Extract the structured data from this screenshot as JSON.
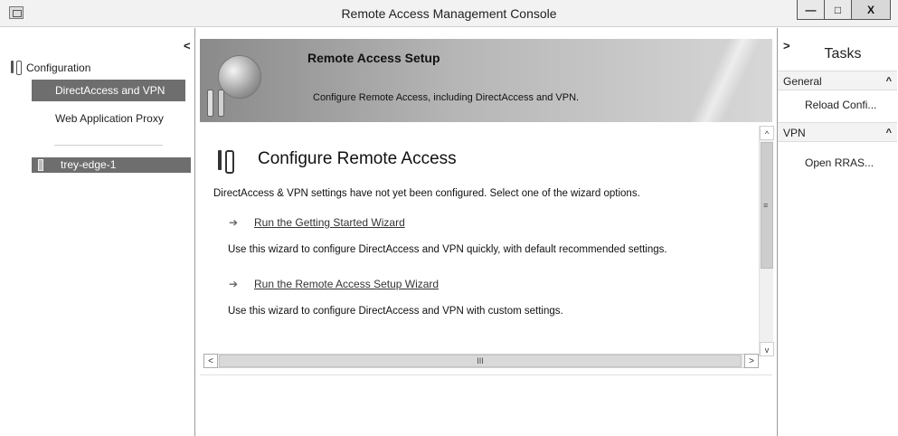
{
  "window": {
    "title": "Remote Access Management Console",
    "minimize_glyph": "—",
    "maximize_glyph": "□",
    "close_glyph": "X"
  },
  "left_pane": {
    "collapse_glyph": "<",
    "root_label": "Configuration",
    "items": [
      {
        "label": "DirectAccess and VPN",
        "selected": true
      },
      {
        "label": "Web Application Proxy",
        "selected": false
      }
    ],
    "server": {
      "label": "trey-edge-1"
    }
  },
  "banner": {
    "title": "Remote Access Setup",
    "subtitle": "Configure Remote Access, including DirectAccess and VPN."
  },
  "main": {
    "title": "Configure Remote Access",
    "intro": "DirectAccess & VPN settings have not yet been configured. Select one of the wizard options.",
    "wizards": [
      {
        "link": "Run the Getting Started Wizard",
        "description": "Use this wizard to configure DirectAccess and VPN quickly, with default recommended settings."
      },
      {
        "link": "Run the Remote Access Setup Wizard",
        "description": "Use this wizard to configure DirectAccess and VPN with custom settings."
      }
    ],
    "scroll": {
      "up": "^",
      "down": "v",
      "grip": "≡",
      "left": "<",
      "right": ">",
      "hgrip": "III"
    }
  },
  "right_pane": {
    "expand_glyph": ">",
    "title": "Tasks",
    "sections": [
      {
        "label": "General",
        "caret": "^",
        "items": [
          "Reload Confi..."
        ]
      },
      {
        "label": "VPN",
        "caret": "^",
        "items": [
          "Open RRAS..."
        ]
      }
    ]
  },
  "icons": [
    "app-icon",
    "tools-icon",
    "server-icon",
    "globe-icon",
    "arrow-icon"
  ]
}
